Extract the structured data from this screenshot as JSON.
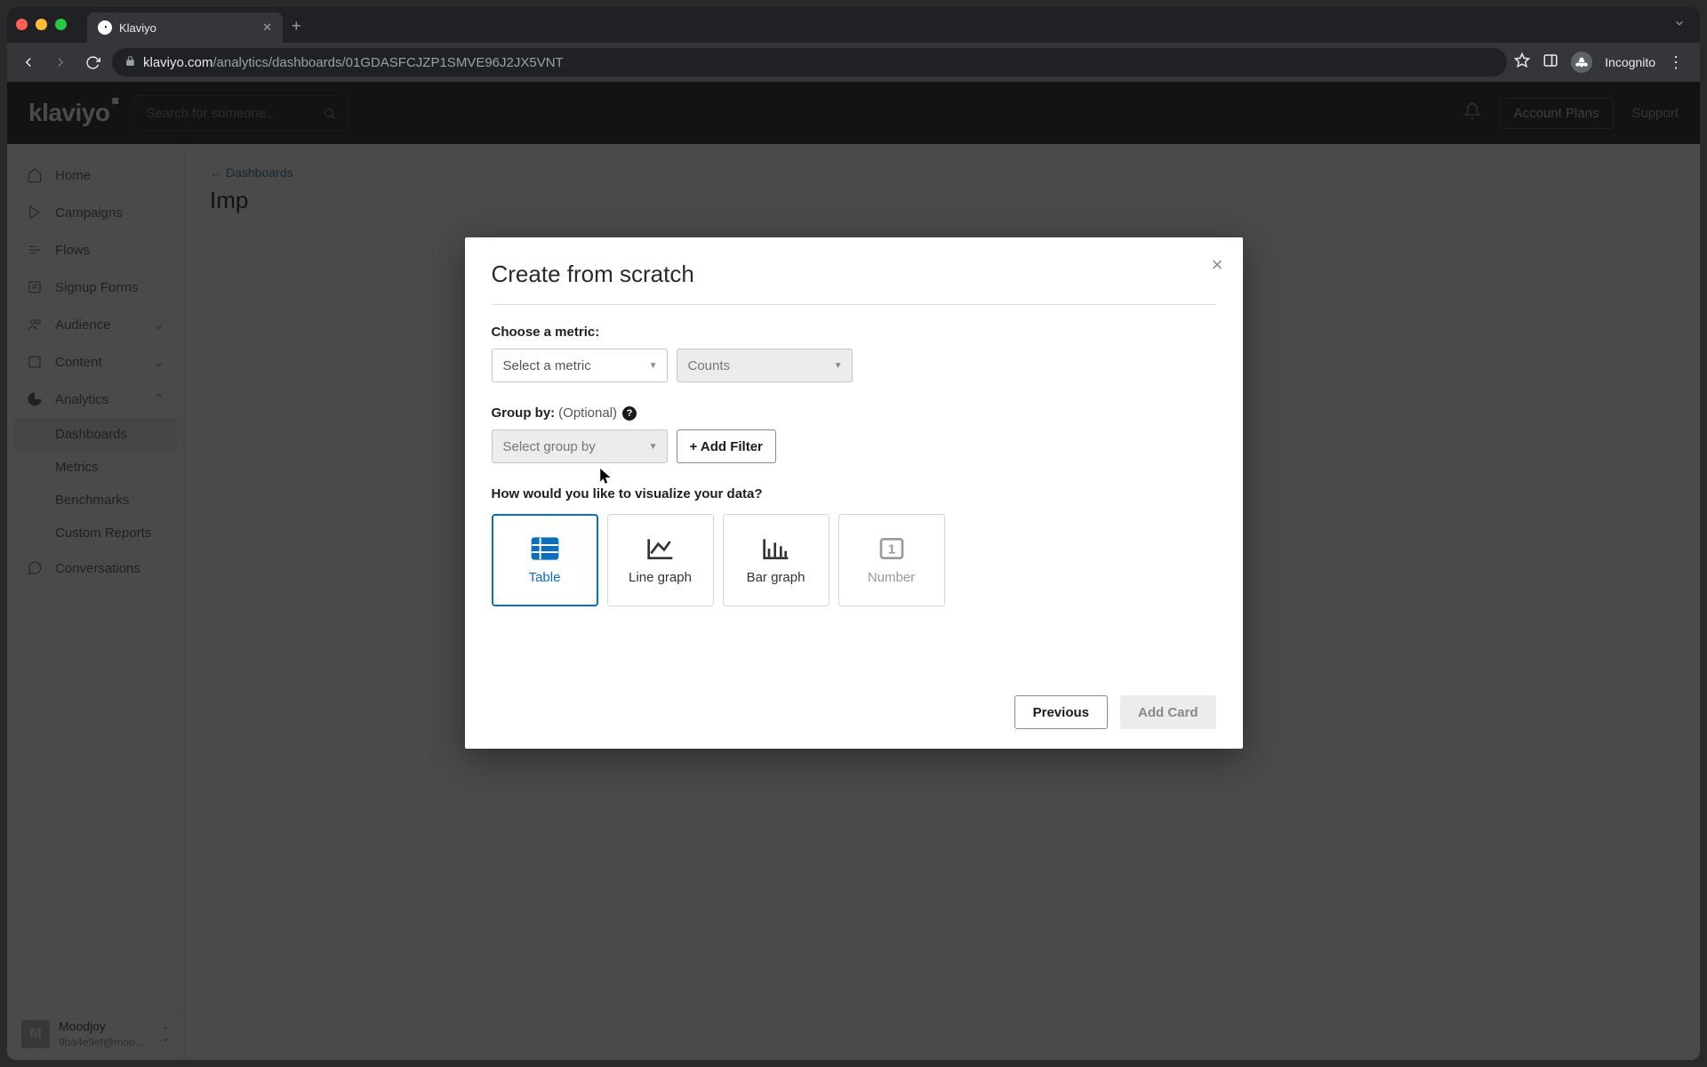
{
  "browser": {
    "tab_title": "Klaviyo",
    "url_host": "klaviyo.com",
    "url_path": "/analytics/dashboards/01GDASFCJZP1SMVE96J2JX5VNT",
    "incognito_label": "Incognito"
  },
  "header": {
    "logo_text": "klaviyo",
    "search_placeholder": "Search for someone...",
    "account_btn": "Account Plans",
    "support_link": "Support"
  },
  "sidebar": {
    "items": [
      {
        "label": "Home"
      },
      {
        "label": "Campaigns"
      },
      {
        "label": "Flows"
      },
      {
        "label": "Signup Forms"
      },
      {
        "label": "Audience"
      },
      {
        "label": "Content"
      },
      {
        "label": "Analytics"
      },
      {
        "label": "Conversations"
      }
    ],
    "analytics_sub": [
      {
        "label": "Dashboards",
        "active": true
      },
      {
        "label": "Metrics"
      },
      {
        "label": "Benchmarks"
      },
      {
        "label": "Custom Reports"
      }
    ],
    "user": {
      "initial": "M",
      "name": "Moodjoy",
      "email": "9ba4e9ef@moo..."
    }
  },
  "page": {
    "back_label": "Dashboards",
    "title_prefix": "Imp"
  },
  "modal": {
    "title": "Create from scratch",
    "metric_label": "Choose a metric:",
    "metric_placeholder": "Select a metric",
    "counts_label": "Counts",
    "group_label": "Group by:",
    "group_optional": "(Optional)",
    "group_placeholder": "Select group by",
    "add_filter_label": "+ Add Filter",
    "viz_label": "How would you like to visualize your data?",
    "viz_options": [
      {
        "label": "Table"
      },
      {
        "label": "Line graph"
      },
      {
        "label": "Bar graph"
      },
      {
        "label": "Number"
      }
    ],
    "previous_btn": "Previous",
    "add_card_btn": "Add Card"
  }
}
